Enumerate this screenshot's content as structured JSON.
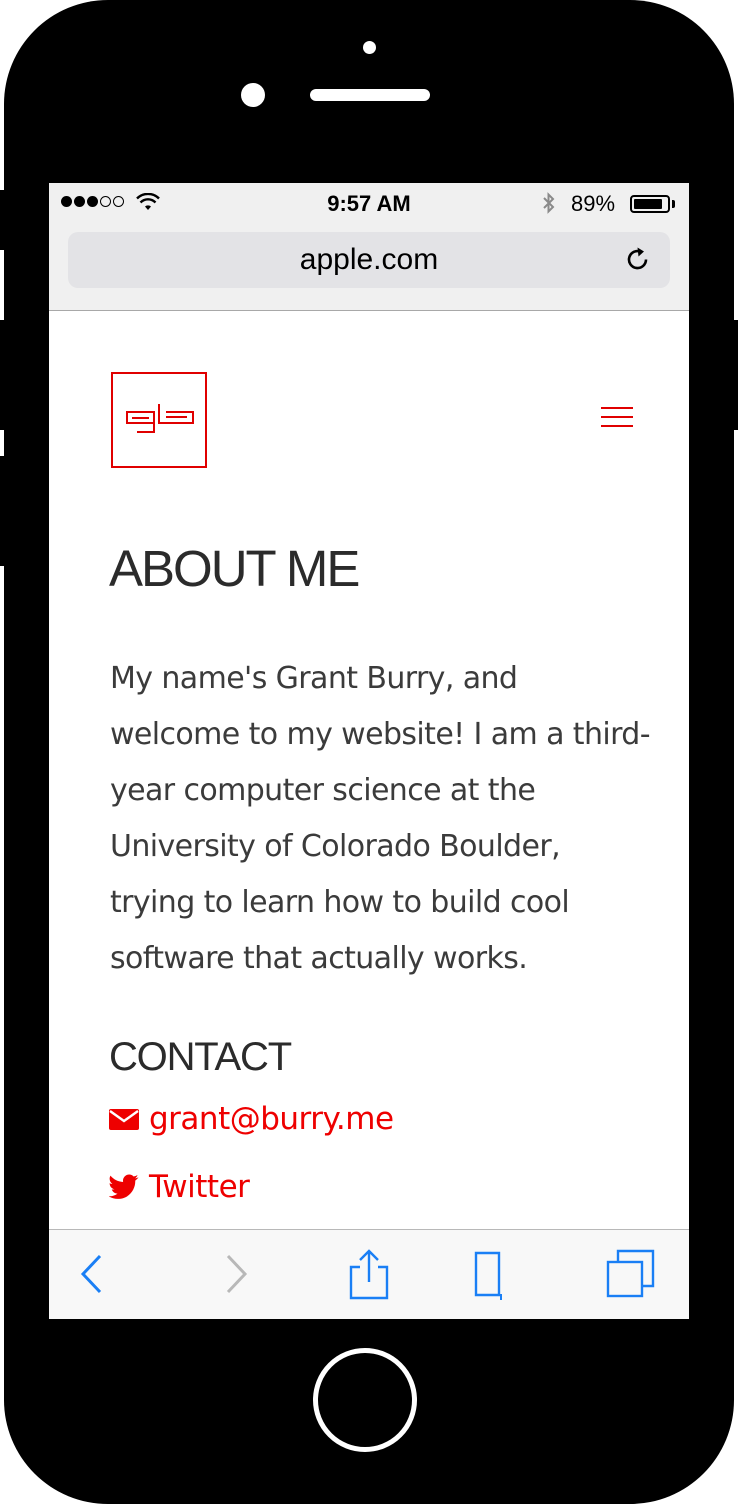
{
  "status_bar": {
    "time": "9:57 AM",
    "battery_percent": "89%",
    "battery_level": 0.89
  },
  "browser": {
    "url": "apple.com"
  },
  "page": {
    "title": "ABOUT ME",
    "about_text": "My name's Grant Burry, and welcome to my website! I am a third-year computer science at the University of Colorado Boulder, trying to learn how to build cool software that actually works.",
    "contact_heading": "CONTACT",
    "contact_links": [
      {
        "label": "grant@burry.me",
        "icon": "envelope-icon"
      },
      {
        "label": "Twitter",
        "icon": "twitter-icon"
      }
    ]
  },
  "colors": {
    "accent": "#ee0000",
    "text": "#2b2b2b",
    "ios_blue": "#1a7ff5"
  }
}
